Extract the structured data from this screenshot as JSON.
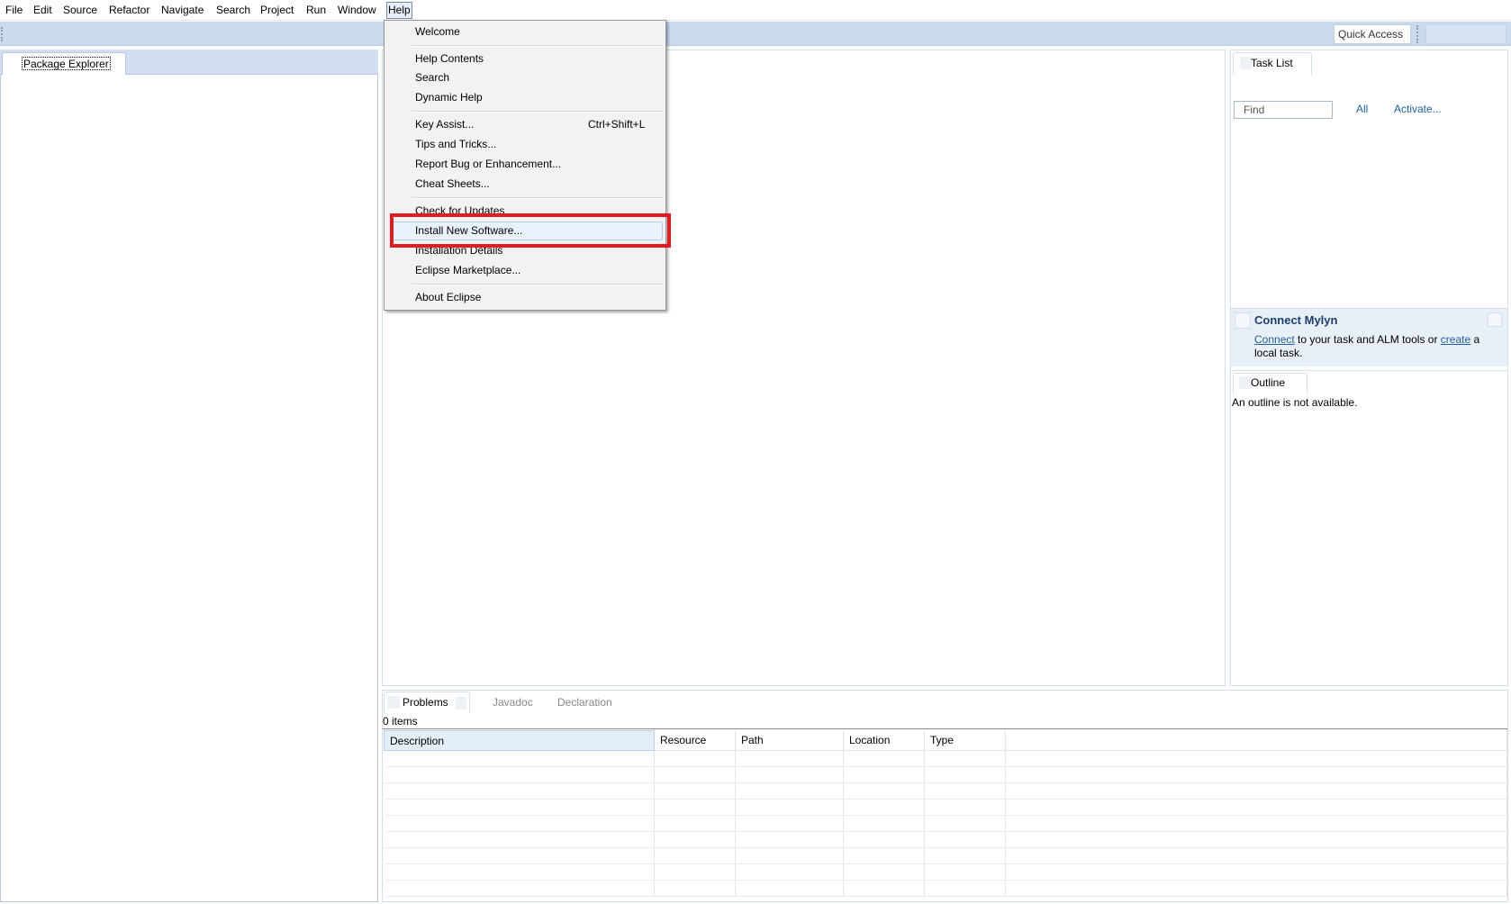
{
  "menubar": {
    "items": [
      "File",
      "Edit",
      "Source",
      "Refactor",
      "Navigate",
      "Search",
      "Project",
      "Run",
      "Window",
      "Help"
    ],
    "active": "Help"
  },
  "toolbar": {
    "quick_access": "Quick Access"
  },
  "package_explorer": {
    "tab_label": "Package Explorer"
  },
  "task_list": {
    "tab_label": "Task List",
    "find_placeholder": "Find",
    "all_label": "All",
    "activate_label": "Activate..."
  },
  "mylyn": {
    "title": "Connect Mylyn",
    "connect_link": "Connect",
    "text_middle": " to your task and ALM tools or ",
    "create_link": "create",
    "text_end": " a local task."
  },
  "outline": {
    "tab_label": "Outline",
    "message": "An outline is not available."
  },
  "bottom": {
    "tabs": [
      "Problems",
      "Javadoc",
      "Declaration"
    ],
    "items_count": "0 items",
    "columns": [
      "Description",
      "Resource",
      "Path",
      "Location",
      "Type"
    ]
  },
  "help_menu": {
    "items": [
      {
        "label": "Welcome"
      },
      {
        "label": "Help Contents"
      },
      {
        "label": "Search"
      },
      {
        "label": "Dynamic Help"
      },
      {
        "label": "Key Assist...",
        "accelerator": "Ctrl+Shift+L"
      },
      {
        "label": "Tips and Tricks..."
      },
      {
        "label": "Report Bug or Enhancement..."
      },
      {
        "label": "Cheat Sheets..."
      },
      {
        "label": "Check for Updates"
      },
      {
        "label": "Install New Software..."
      },
      {
        "label": "Installation Details"
      },
      {
        "label": "Eclipse Marketplace..."
      },
      {
        "label": "About Eclipse"
      }
    ],
    "highlighted": "Install New Software..."
  },
  "colors": {
    "highlight_box": "#e01c22",
    "toolbar_bg": "#c9daef",
    "link": "#1f5f9c"
  }
}
